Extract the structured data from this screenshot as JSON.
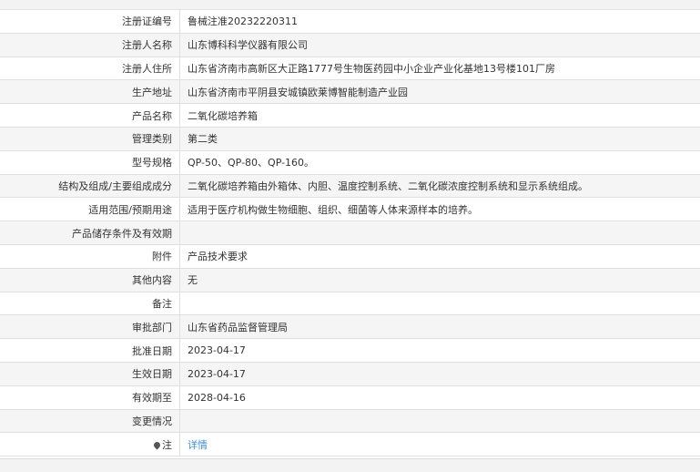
{
  "rows": [
    {
      "label": "注册证编号",
      "value": "鲁械注准20232220311"
    },
    {
      "label": "注册人名称",
      "value": "山东博科科学仪器有限公司"
    },
    {
      "label": "注册人住所",
      "value": "山东省济南市高新区大正路1777号生物医药园中小企业产业化基地13号楼101厂房"
    },
    {
      "label": "生产地址",
      "value": "山东省济南市平阴县安城镇欧莱博智能制造产业园"
    },
    {
      "label": "产品名称",
      "value": "二氧化碳培养箱"
    },
    {
      "label": "管理类别",
      "value": "第二类"
    },
    {
      "label": "型号规格",
      "value": "QP-50、QP-80、QP-160。"
    },
    {
      "label": "结构及组成/主要组成成分",
      "value": "二氧化碳培养箱由外箱体、内胆、温度控制系统、二氧化碳浓度控制系统和显示系统组成。"
    },
    {
      "label": "适用范围/预期用途",
      "value": "适用于医疗机构做生物细胞、组织、细菌等人体来源样本的培养。"
    },
    {
      "label": "产品储存条件及有效期",
      "value": ""
    },
    {
      "label": "附件",
      "value": "产品技术要求"
    },
    {
      "label": "其他内容",
      "value": "无"
    },
    {
      "label": "备注",
      "value": ""
    },
    {
      "label": "审批部门",
      "value": "山东省药品监督管理局"
    },
    {
      "label": "批准日期",
      "value": "2023-04-17"
    },
    {
      "label": "生效日期",
      "value": "2023-04-17"
    },
    {
      "label": "有效期至",
      "value": "2028-04-16"
    },
    {
      "label": "变更情况",
      "value": ""
    }
  ],
  "note": {
    "label": "注",
    "link": "详情"
  }
}
